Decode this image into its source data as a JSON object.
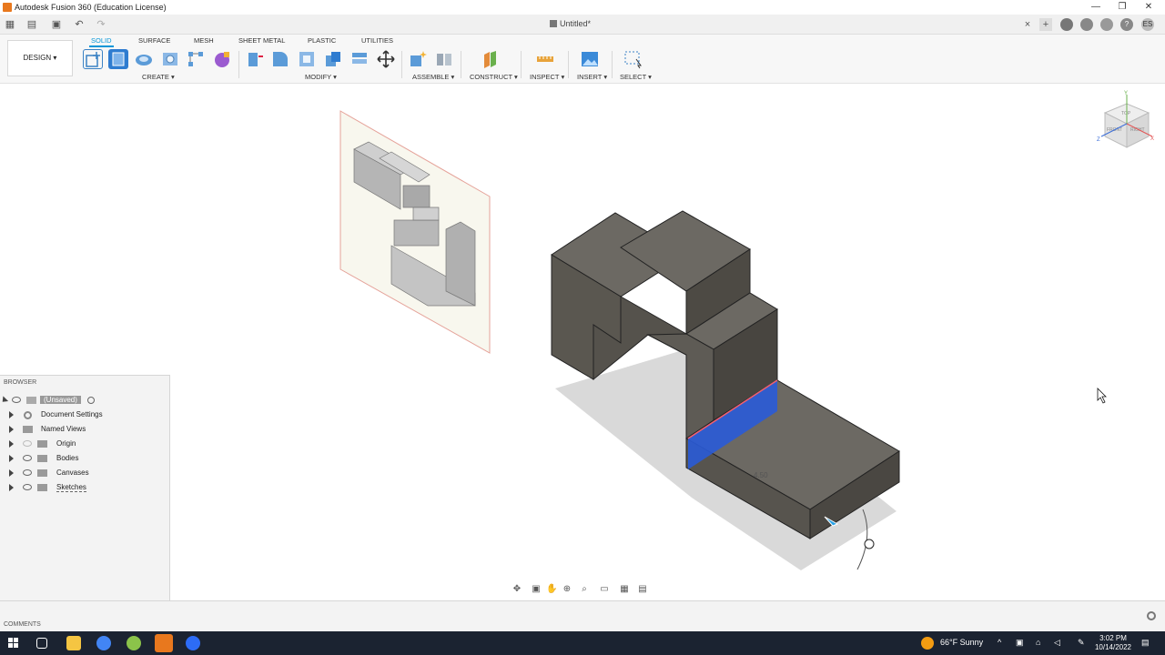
{
  "window": {
    "title": "Autodesk Fusion 360 (Education License)",
    "minimize": "—",
    "restore": "❐",
    "close": "✕"
  },
  "doc_tab": {
    "title": "Untitled*",
    "close": "×",
    "add": "+",
    "user_initials": "ES"
  },
  "toolbar": {
    "workspace": "DESIGN ▾",
    "tabs": [
      "SOLID",
      "SURFACE",
      "MESH",
      "SHEET METAL",
      "PLASTIC",
      "UTILITIES"
    ],
    "groups": {
      "create": "CREATE ▾",
      "modify": "MODIFY ▾",
      "assemble": "ASSEMBLE ▾",
      "construct": "CONSTRUCT ▾",
      "inspect": "INSPECT ▾",
      "insert": "INSERT ▾",
      "select": "SELECT ▾"
    }
  },
  "browser": {
    "header": "BROWSER",
    "root": "(Unsaved)",
    "items": [
      "Document Settings",
      "Named Views",
      "Origin",
      "Bodies",
      "Canvases",
      "Sketches"
    ]
  },
  "comments": {
    "header": "COMMENTS"
  },
  "viewport": {
    "dimension_value": "4.50",
    "viewcube_faces": {
      "top": "TOP",
      "front": "FRONT",
      "right": "RIGHT"
    },
    "axes": {
      "x": "X",
      "y": "Y",
      "z": "Z"
    }
  },
  "taskbar": {
    "weather": "66°F  Sunny",
    "time": "3:02 PM",
    "date": "10/14/2022"
  },
  "colors": {
    "accent": "#0696d7",
    "body": "#5a5750",
    "selection": "#2a5bd7",
    "taskbar": "#1b2331"
  }
}
